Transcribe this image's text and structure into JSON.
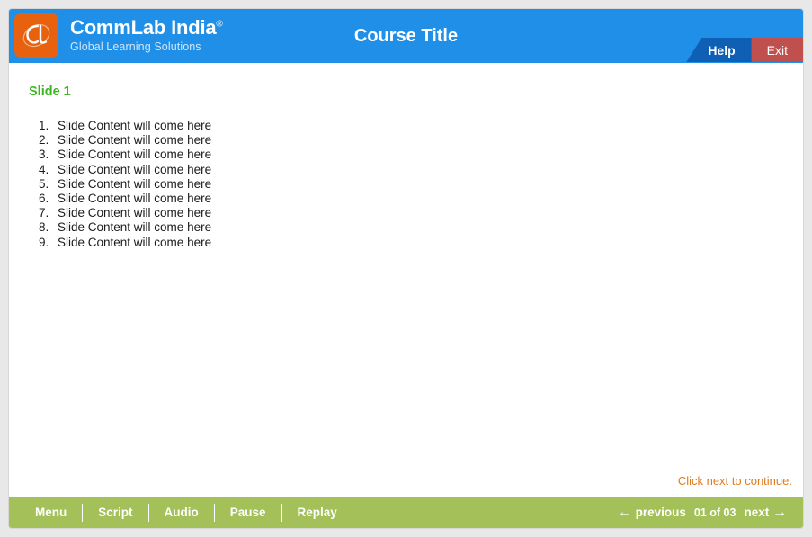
{
  "header": {
    "brand_name": "CommLab India",
    "brand_registered_mark": "®",
    "brand_tagline": "Global Learning Solutions",
    "logo_icon": "cl-monogram-logo",
    "course_title": "Course Title",
    "help_label": "Help",
    "exit_label": "Exit",
    "background_color": "#1f8fe8",
    "help_color": "#0f5fb5",
    "exit_color": "#c0504d",
    "logo_color": "#e8610f"
  },
  "content": {
    "slide_title": "Slide 1",
    "slide_title_color": "#3cb521",
    "list_items": [
      "Slide Content will come here",
      "Slide Content will come here",
      "Slide Content will come here",
      "Slide Content will come here",
      "Slide Content will come here",
      "Slide Content will come here",
      "Slide Content will come here",
      "Slide Content will come here",
      "Slide Content will come here"
    ],
    "continue_hint": "Click next to continue.",
    "continue_hint_color": "#e07b1e"
  },
  "navbar": {
    "background_color": "#a4c059",
    "buttons": [
      {
        "label": "Menu"
      },
      {
        "label": "Script"
      },
      {
        "label": "Audio"
      },
      {
        "label": "Pause"
      },
      {
        "label": "Replay"
      }
    ],
    "previous_label": "previous",
    "previous_arrow": "←",
    "next_label": "next",
    "next_arrow": "→",
    "page_counter": "01 of 03"
  }
}
